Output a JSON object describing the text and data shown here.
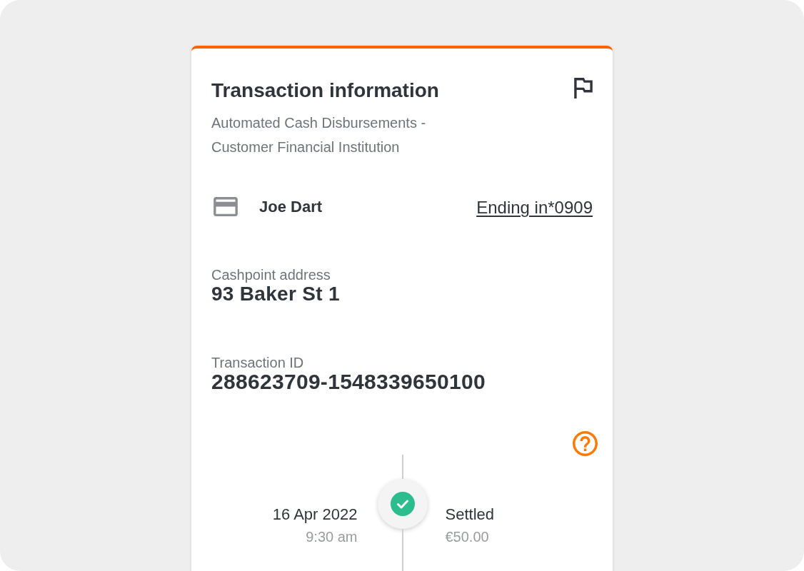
{
  "card": {
    "title": "Transaction information",
    "subtitle": "Automated Cash Disbursements - Customer Financial Institution",
    "account": {
      "holder": "Joe Dart",
      "card_link": "Ending in*0909"
    },
    "details": [
      {
        "label": "Cashpoint address",
        "value": "93 Baker St 1"
      },
      {
        "label": "Transaction ID",
        "value": "288623709-1548339650100"
      }
    ],
    "timeline": [
      {
        "date": "16 Apr 2022",
        "time": "9:30 am",
        "status": "Settled",
        "amount": "€50.00",
        "done": true
      }
    ]
  }
}
